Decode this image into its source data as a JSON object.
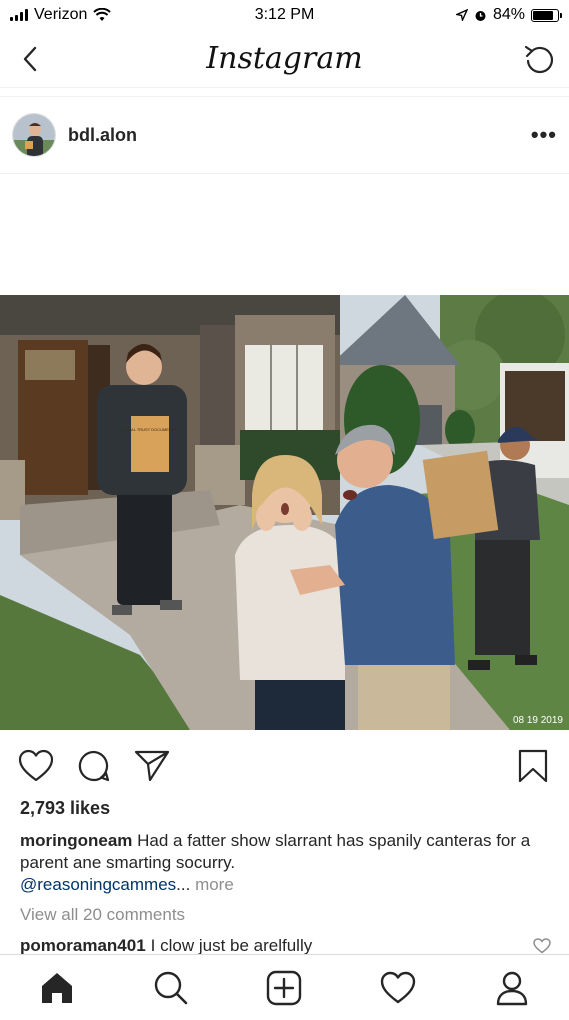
{
  "status_bar": {
    "carrier": "Verizon",
    "time": "3:12 PM",
    "battery": "84%",
    "battery_level": 0.84,
    "icons": [
      "signal-icon",
      "wifi-icon",
      "location-icon",
      "alarm-icon",
      "battery-icon"
    ]
  },
  "nav": {
    "title": "Instagram",
    "back_icon": "chevron-left-icon",
    "refresh_icon": "refresh-icon"
  },
  "post": {
    "username": "bdl.alon",
    "more": "•••",
    "photo_date": "08 19 2019",
    "photo_sign": "LEGAL TRUST DOCUMENTS",
    "likes": "2,793 likes",
    "caption_user": "moringoneam",
    "caption_text": "Had a fatter show slarrant has spanily canteras for a parent ane smarting socurry.",
    "caption_mention": "@reasoningcammes",
    "caption_ellipsis": "...",
    "caption_more": "more",
    "view_comments": "View all 20 comments",
    "comment_user": "pomoraman401",
    "comment_text": "I clow just be arelfully"
  },
  "tabs": [
    "home-icon",
    "search-icon",
    "add-icon",
    "activity-icon",
    "profile-icon"
  ],
  "colors": {
    "text": "#262626",
    "muted": "#8e8e8e",
    "mention": "#003569",
    "divider": "#efefef"
  }
}
